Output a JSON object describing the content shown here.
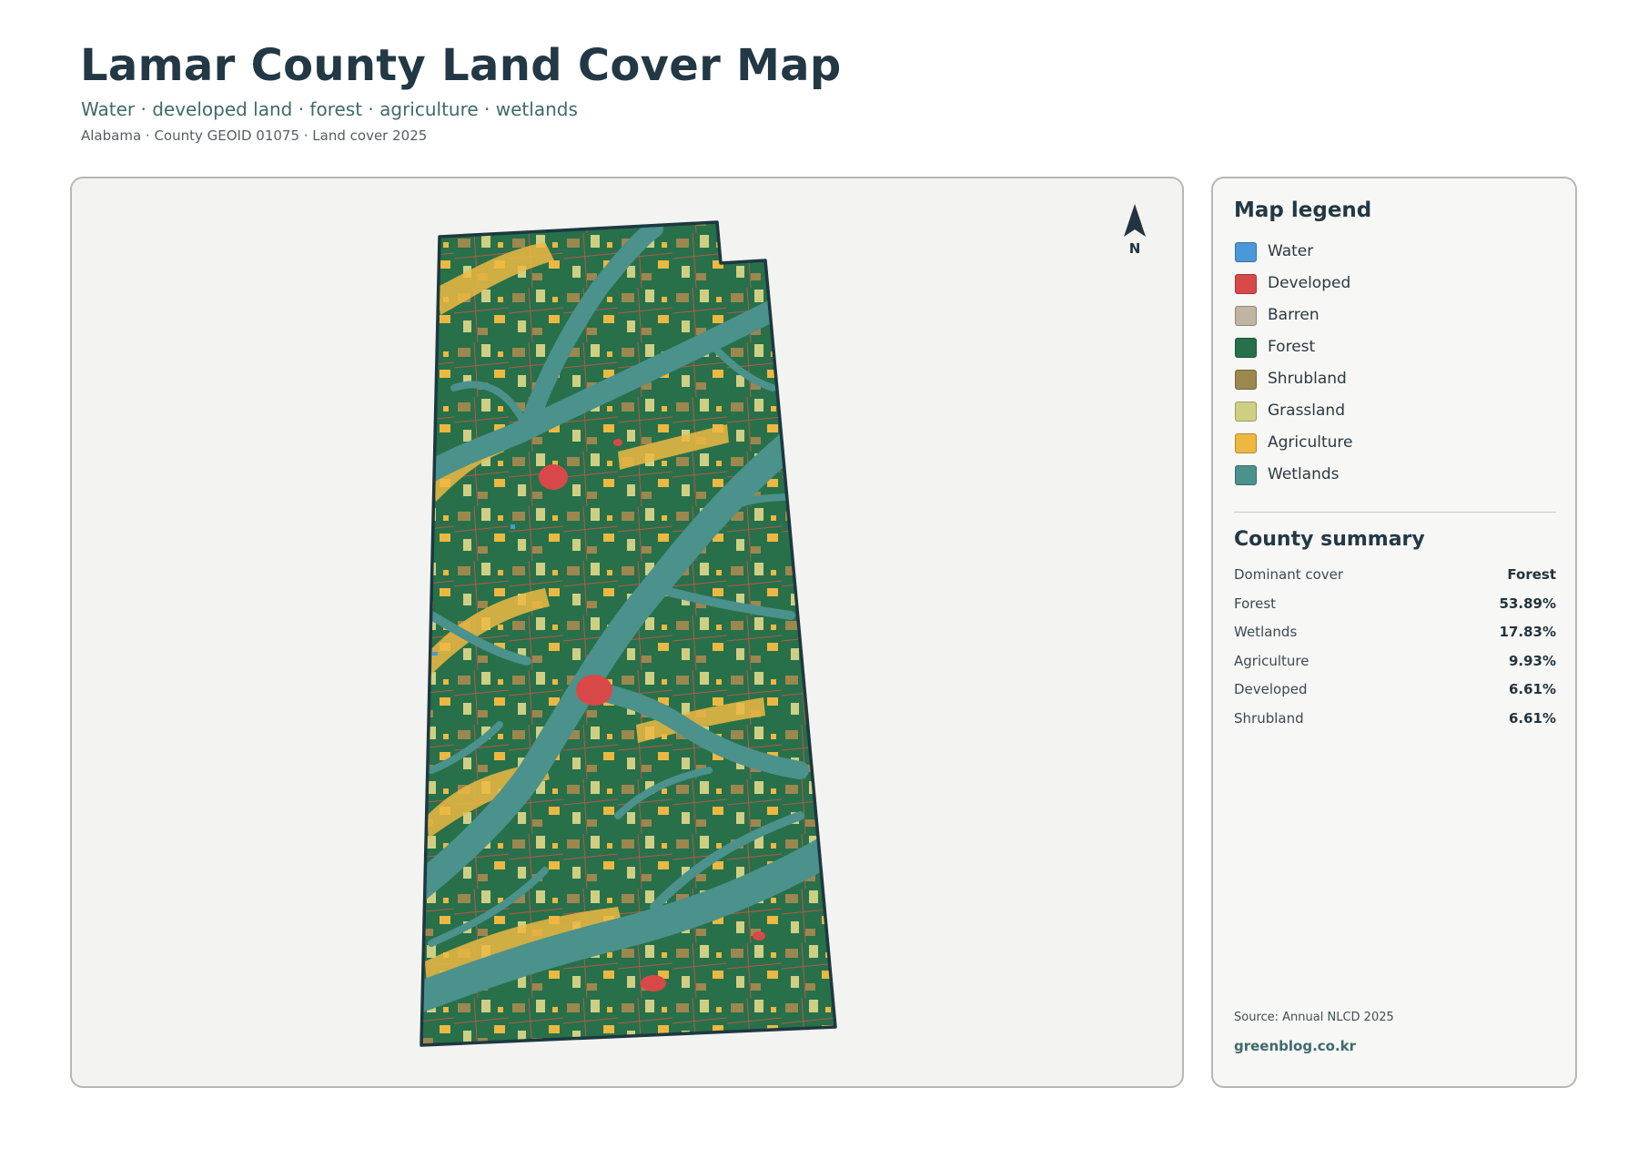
{
  "header": {
    "title": "Lamar County Land Cover Map",
    "subtitle": "Water · developed land · forest · agriculture · wetlands",
    "meta": "Alabama · County GEOID 01075 · Land cover 2025"
  },
  "map": {
    "north_label": "N",
    "icons": {
      "north_arrow": "north-arrow-icon"
    }
  },
  "legend": {
    "title": "Map legend",
    "items": [
      {
        "label": "Water",
        "color": "#4a98d8"
      },
      {
        "label": "Developed",
        "color": "#d94848"
      },
      {
        "label": "Barren",
        "color": "#bfb5a2"
      },
      {
        "label": "Forest",
        "color": "#27704a"
      },
      {
        "label": "Shrubland",
        "color": "#9c874f"
      },
      {
        "label": "Grassland",
        "color": "#cfcf84"
      },
      {
        "label": "Agriculture",
        "color": "#edb842"
      },
      {
        "label": "Wetlands",
        "color": "#4b918c"
      }
    ]
  },
  "summary": {
    "title": "County summary",
    "rows": [
      {
        "label": "Dominant cover",
        "value": "Forest"
      },
      {
        "label": "Forest",
        "value": "53.89%"
      },
      {
        "label": "Wetlands",
        "value": "17.83%"
      },
      {
        "label": "Agriculture",
        "value": "9.93%"
      },
      {
        "label": "Developed",
        "value": "6.61%"
      },
      {
        "label": "Shrubland",
        "value": "6.61%"
      }
    ]
  },
  "footer": {
    "source": "Source: Annual NLCD 2025",
    "site": "greenblog.co.kr"
  }
}
